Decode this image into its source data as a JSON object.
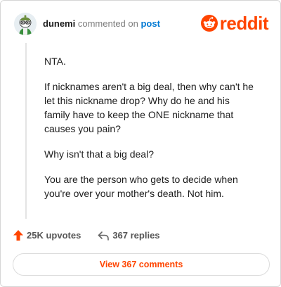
{
  "header": {
    "username": "dunemi",
    "action_text": "commented on",
    "post_link": "post"
  },
  "brand": {
    "logo_text": "reddit",
    "accent_color": "#ff4500"
  },
  "comment": {
    "paragraphs": [
      "NTA.",
      "If nicknames aren't a big deal, then why can't he let this nickname drop? Why do he and his family have to keep the ONE nickname that causes you pain?",
      "Why isn't that a big deal?",
      "You are the person who gets to decide when you're over your mother's death. Not him."
    ]
  },
  "actions": {
    "upvotes": "25K upvotes",
    "replies": "367 replies"
  },
  "footer": {
    "view_button": "View 367 comments"
  },
  "icons": {
    "avatar": "snoo-avatar",
    "upvote": "upvote-arrow-icon",
    "reply": "reply-arrow-icon",
    "logo": "reddit-snoo-logo-icon"
  }
}
